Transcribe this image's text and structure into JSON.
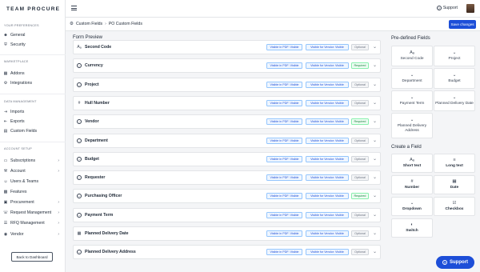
{
  "app": {
    "logo": "TEAM PROCURE"
  },
  "sidebar": {
    "sections": [
      {
        "title": "YOUR PREFERENCES",
        "items": [
          {
            "label": "General",
            "icon": "person-icon",
            "chevron": false
          },
          {
            "label": "Security",
            "icon": "shield-icon",
            "chevron": false
          }
        ]
      },
      {
        "title": "MARKETPLACE",
        "items": [
          {
            "label": "Addons",
            "icon": "grid-icon",
            "chevron": false
          },
          {
            "label": "Integrations",
            "icon": "plug-icon",
            "chevron": false
          }
        ]
      },
      {
        "title": "DATA MANAGEMENT",
        "items": [
          {
            "label": "Imports",
            "icon": "import-icon",
            "chevron": false
          },
          {
            "label": "Exports",
            "icon": "export-icon",
            "chevron": false
          },
          {
            "label": "Custom Fields",
            "icon": "fields-icon",
            "chevron": false
          }
        ]
      },
      {
        "title": "ACCOUNT SETUP",
        "items": [
          {
            "label": "Subscriptions",
            "icon": "card-icon",
            "chevron": true
          },
          {
            "label": "Account",
            "icon": "wrench-icon",
            "chevron": true
          },
          {
            "label": "Users & Teams",
            "icon": "users-icon",
            "chevron": false
          },
          {
            "label": "Features",
            "icon": "features-icon",
            "chevron": false
          },
          {
            "label": "Procurement",
            "icon": "cart-icon",
            "chevron": true
          },
          {
            "label": "Request Management",
            "icon": "request-icon",
            "chevron": true
          },
          {
            "label": "RFQ Management",
            "icon": "rfq-icon",
            "chevron": true
          },
          {
            "label": "Vendor",
            "icon": "vendor-icon",
            "chevron": true
          }
        ]
      }
    ],
    "back_button": "Back to Dashboard"
  },
  "topbar": {
    "support_label": "Support"
  },
  "breadcrumb": {
    "items": [
      "Custom Fields",
      "PO Custom Fields"
    ]
  },
  "actions": {
    "save_label": "Save changes"
  },
  "form": {
    "title": "Form Preview",
    "pdf_label": "Visible in PDF: Visible",
    "vendor_label": "Visible for Vendor: Visible",
    "fields": [
      {
        "label": "Second Code",
        "icon": "text-icon",
        "status": "Optional"
      },
      {
        "label": "Currency",
        "icon": "circle-chevron-icon",
        "status": "Required"
      },
      {
        "label": "Project",
        "icon": "circle-chevron-icon",
        "status": "Optional"
      },
      {
        "label": "Hull Number",
        "icon": "number-icon",
        "status": "Optional"
      },
      {
        "label": "Vendor",
        "icon": "circle-chevron-icon",
        "status": "Required"
      },
      {
        "label": "Department",
        "icon": "circle-chevron-icon",
        "status": "Optional"
      },
      {
        "label": "Budget",
        "icon": "circle-chevron-icon",
        "status": "Optional"
      },
      {
        "label": "Requester",
        "icon": "circle-chevron-icon",
        "status": "Optional"
      },
      {
        "label": "Purchasing Officer",
        "icon": "circle-chevron-icon",
        "status": "Required"
      },
      {
        "label": "Payment Term",
        "icon": "circle-chevron-icon",
        "status": "Optional"
      },
      {
        "label": "Planned Delivery Date",
        "icon": "calendar-icon",
        "status": "Optional"
      },
      {
        "label": "Planned Delivery Address",
        "icon": "circle-chevron-icon",
        "status": "Optional"
      }
    ]
  },
  "predefined": {
    "title": "Pre-defined Fields",
    "items": [
      {
        "label": "Second Code",
        "icon": "text-icon"
      },
      {
        "label": "Project",
        "icon": "circle-chevron-icon"
      },
      {
        "label": "Department",
        "icon": "circle-chevron-icon"
      },
      {
        "label": "Budget",
        "icon": "circle-chevron-icon"
      },
      {
        "label": "Payment Term",
        "icon": "circle-chevron-icon"
      },
      {
        "label": "Planned Delivery Date",
        "icon": "circle-chevron-icon"
      },
      {
        "label": "Planned Delivery Address",
        "icon": "circle-chevron-icon"
      }
    ]
  },
  "create": {
    "title": "Create a Field",
    "items": [
      {
        "label": "Short text",
        "icon": "text-icon"
      },
      {
        "label": "Long text",
        "icon": "long-text-icon"
      },
      {
        "label": "Number",
        "icon": "number-icon"
      },
      {
        "label": "Date",
        "icon": "calendar-icon"
      },
      {
        "label": "Dropdown",
        "icon": "circle-chevron-icon"
      },
      {
        "label": "Checkbox",
        "icon": "checkbox-icon"
      },
      {
        "label": "Switch",
        "icon": "toggle-icon"
      }
    ]
  },
  "support_float": {
    "label": "Support"
  },
  "colors": {
    "primary": "#1d4ed8",
    "required": "#15803d",
    "optional": "#6b7280"
  }
}
